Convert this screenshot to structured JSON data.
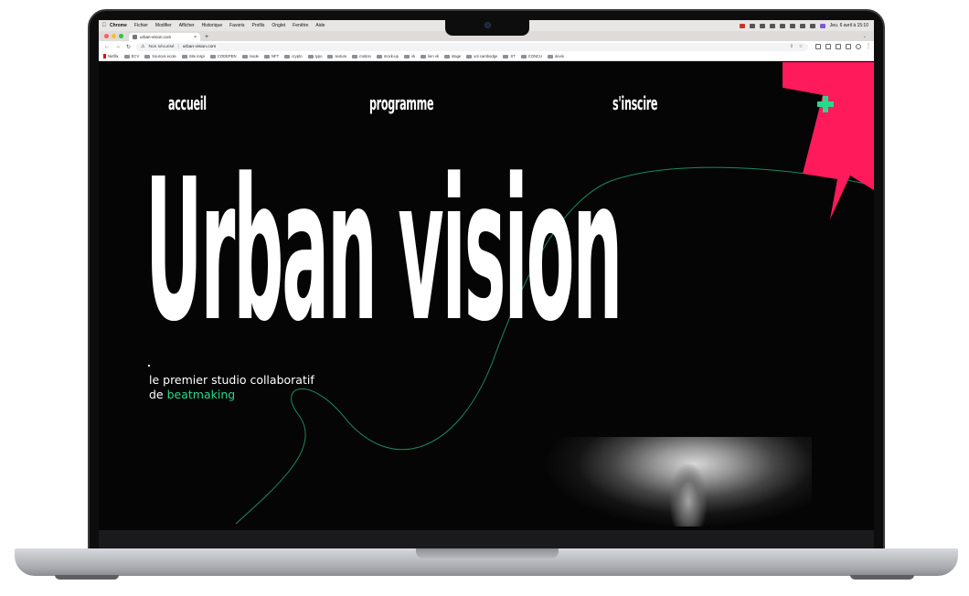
{
  "menubar": {
    "app": "Chrome",
    "items": [
      "Fichier",
      "Modifier",
      "Afficher",
      "Historique",
      "Favoris",
      "Profils",
      "Onglet",
      "Fenêtre",
      "Aide"
    ],
    "clock": "Jeu. 6 avril à 15:10"
  },
  "browser": {
    "tab_title": "urban-vision.com",
    "insecure_label": "Non sécurisé",
    "url": "urban-vision.com",
    "bookmarks": [
      "Netflix",
      "ECV",
      "Sources ecole",
      "Site inspi",
      "CODEPEN",
      "mode",
      "NFT",
      "crypto",
      "typo",
      "texture",
      "motion",
      "mock-up",
      "vk",
      "lien vk",
      "stage",
      "vol cambodge",
      "ST",
      "CONCU",
      "devis"
    ]
  },
  "site": {
    "nav": {
      "home": "accueil",
      "program": "programme",
      "signup": "s'inscire"
    },
    "hero_title": "Urban vision",
    "subtitle_line1": "le premier studio collaboratif",
    "subtitle_line2_prefix": "de",
    "subtitle_accent": "beatmaking"
  },
  "colors": {
    "background": "#050505",
    "accent_green": "#25d98a",
    "accent_pink": "#ff1a5c",
    "text": "#ffffff"
  },
  "icons": {
    "plus": "plus-icon",
    "apple": "apple-logo"
  }
}
